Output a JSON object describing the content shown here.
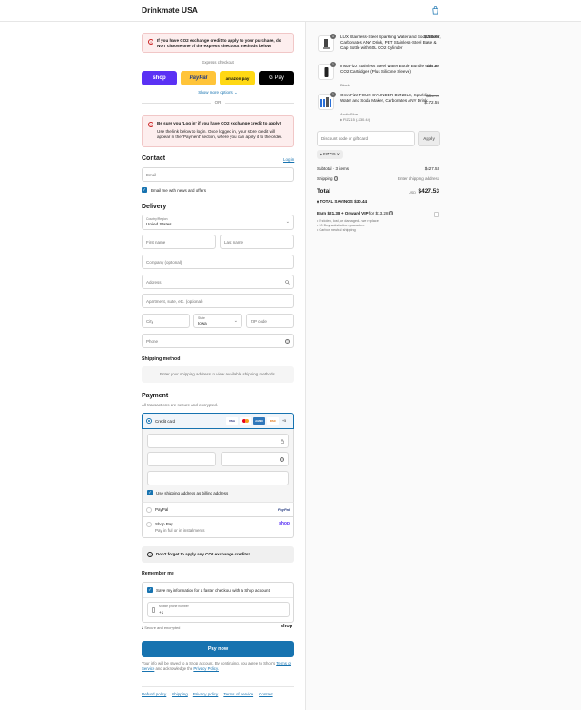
{
  "header": {
    "brand": "Drinkmate USA"
  },
  "alert1": {
    "text": "If you have CO2 exchange credit to apply to your purchase, do NOT choose one of the express checkout methods below."
  },
  "express": {
    "title": "Express checkout",
    "shop": "shop",
    "paypal": "PayPal",
    "amazon": "amazon pay",
    "gpay": "G Pay",
    "more": "Show more options",
    "or": "OR"
  },
  "alert2": {
    "title": "Be sure you 'Log in' if you have CO2 exchange credit to apply!",
    "body": "Use the link below to login. Once logged in, your store credit will appear in the 'Payment' section, where you can apply it to the order."
  },
  "contact": {
    "heading": "Contact",
    "login": "Log in",
    "email_placeholder": "Email",
    "news_label": "Email me with news and offers"
  },
  "delivery": {
    "heading": "Delivery",
    "country_label": "Country/Region",
    "country_value": "United States",
    "first_name": "First name",
    "last_name": "Last name",
    "company": "Company (optional)",
    "address": "Address",
    "apartment": "Apartment, suite, etc. (optional)",
    "city": "City",
    "state_label": "State",
    "state_value": "Iowa",
    "zip": "ZIP code",
    "phone": "Phone"
  },
  "shipping": {
    "heading": "Shipping method",
    "message": "Enter your shipping address to view available shipping methods."
  },
  "payment": {
    "heading": "Payment",
    "subtitle": "All transactions are secure and encrypted.",
    "credit_card": "Credit card",
    "visa": "VISA",
    "mc": "MC",
    "amex": "AMEX",
    "discover": "DISC",
    "more_cards": "+5",
    "billing_label": "Use shipping address as billing address",
    "paypal_label": "PayPal",
    "paypal_logo": "PayPal",
    "shoppay_label": "Shop Pay",
    "shoppay_sub": "Pay in full or in installments",
    "shoppay_logo": "shop"
  },
  "credits_alert": {
    "text": "Don't forget to apply any CO2 exchange credits!"
  },
  "remember": {
    "heading": "Remember me",
    "save_label": "Save my information for a faster checkout with a Shop account",
    "phone_label": "Mobile phone number",
    "phone_value": "+1",
    "secure": "Secure and encrypted",
    "shop_logo": "shop"
  },
  "pay": {
    "button": "Pay now",
    "terms_prefix": "Your info will be saved to a Shop account. By continuing, you agree to Shop's",
    "terms_link": "Terms of Service",
    "terms_mid": "and acknowledge the",
    "privacy_link": "Privacy Policy."
  },
  "footer": {
    "links": [
      "Refund policy",
      "Shipping",
      "Privacy policy",
      "Terms of service",
      "Contact"
    ]
  },
  "cart": {
    "items": [
      {
        "qty": "1",
        "name": "LUX Stainless-Steel Sparkling Water and Soda Maker, Carbonates ANY Drink, PET Stainless-Steel Base & Cap Bottle with 60L CO2 Cylinder",
        "sub": "",
        "price": "$219.99",
        "old_price": ""
      },
      {
        "qty": "1",
        "name": "InstaFizz Stainless Steel Water Bottle Bundle with 10 CO2 Cartridges (Plus Silicone Sleeve)",
        "sub": "Black",
        "price": "$34.99",
        "old_price": ""
      },
      {
        "qty": "1",
        "name": "OmniFizz FOUR CYLINDER BUNDLE, Sparkling Water and Soda Maker, Carbonates ANY Drink",
        "sub": "Arctic Blue",
        "discount": "FIZZ15 (-$30.44)",
        "price": "$172.55",
        "old_price": "$202.99"
      }
    ],
    "discount_placeholder": "Discount code or gift card",
    "apply": "Apply",
    "code_tag": "FIZZ15",
    "subtotal_label": "Subtotal · 3 items",
    "subtotal_value": "$427.53",
    "shipping_label": "Shipping",
    "shipping_value": "Enter shipping address",
    "total_label": "Total",
    "currency": "USD",
    "total_value": "$427.53",
    "savings_label": "TOTAL SAVINGS",
    "savings_value": "$30.44",
    "vip_title_bold": "Earn $21.38 + Onward VIP",
    "vip_title_rest": "for $13.28",
    "vip_bullets": [
      "If stolen, lost, or damaged - we replace",
      "90 Day satisfaction guarantee",
      "Carbon neutral shipping"
    ]
  }
}
